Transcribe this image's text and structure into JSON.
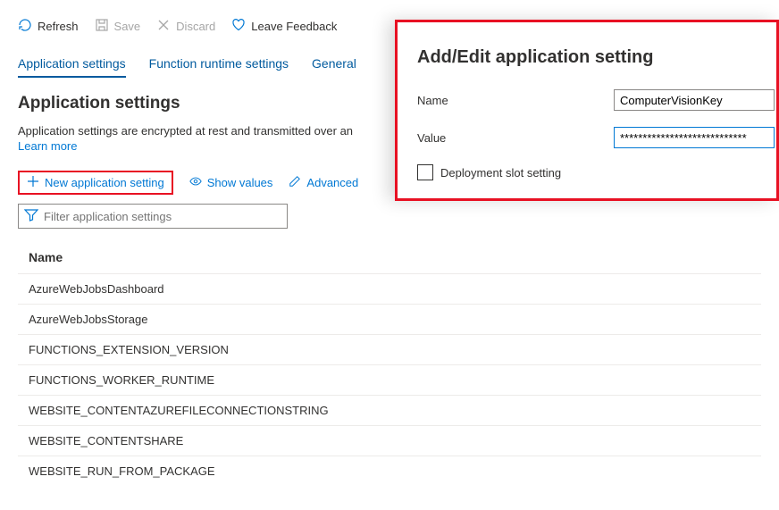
{
  "toolbar": {
    "refresh": "Refresh",
    "save": "Save",
    "discard": "Discard",
    "feedback": "Leave Feedback"
  },
  "tabs": {
    "app": "Application settings",
    "runtime": "Function runtime settings",
    "general": "General"
  },
  "section": {
    "title": "Application settings",
    "desc": "Application settings are encrypted at rest and transmitted over an",
    "learn": "Learn more"
  },
  "actions": {
    "new": "New application setting",
    "show": "Show values",
    "advanced": "Advanced"
  },
  "filter": {
    "placeholder": "Filter application settings"
  },
  "table": {
    "header": "Name",
    "rows": [
      "AzureWebJobsDashboard",
      "AzureWebJobsStorage",
      "FUNCTIONS_EXTENSION_VERSION",
      "FUNCTIONS_WORKER_RUNTIME",
      "WEBSITE_CONTENTAZUREFILECONNECTIONSTRING",
      "WEBSITE_CONTENTSHARE",
      "WEBSITE_RUN_FROM_PACKAGE"
    ]
  },
  "panel": {
    "title": "Add/Edit application setting",
    "name_label": "Name",
    "name_value": "ComputerVisionKey",
    "value_label": "Value",
    "value_value": "****************************",
    "slot_label": "Deployment slot setting"
  }
}
